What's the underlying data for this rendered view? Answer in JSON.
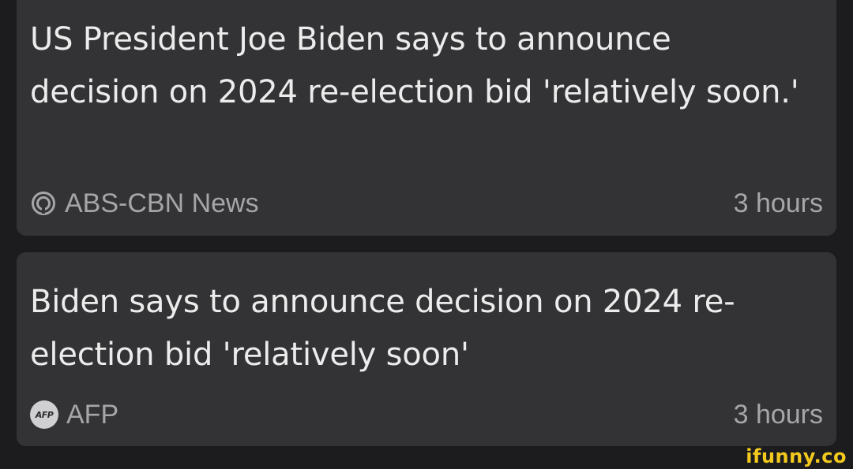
{
  "feed": {
    "items": [
      {
        "headline": "US President Joe Biden says to announce decision on 2024 re-election bid 'relatively soon.'",
        "source": "ABS-CBN News",
        "source_icon": "abs-cbn-logo-icon",
        "time": "3 hours"
      },
      {
        "headline": "Biden says to announce decision on 2024 re-election bid 'relatively soon'",
        "source": "AFP",
        "source_icon": "afp-logo-icon",
        "source_icon_text": "AFP",
        "time": "3 hours"
      }
    ]
  },
  "watermark": "ifunny.co",
  "colors": {
    "background": "#1c1c1e",
    "card": "#333335",
    "headline_text": "#ececec",
    "meta_text": "#a6a6a8",
    "watermark": "#f2c91c"
  }
}
